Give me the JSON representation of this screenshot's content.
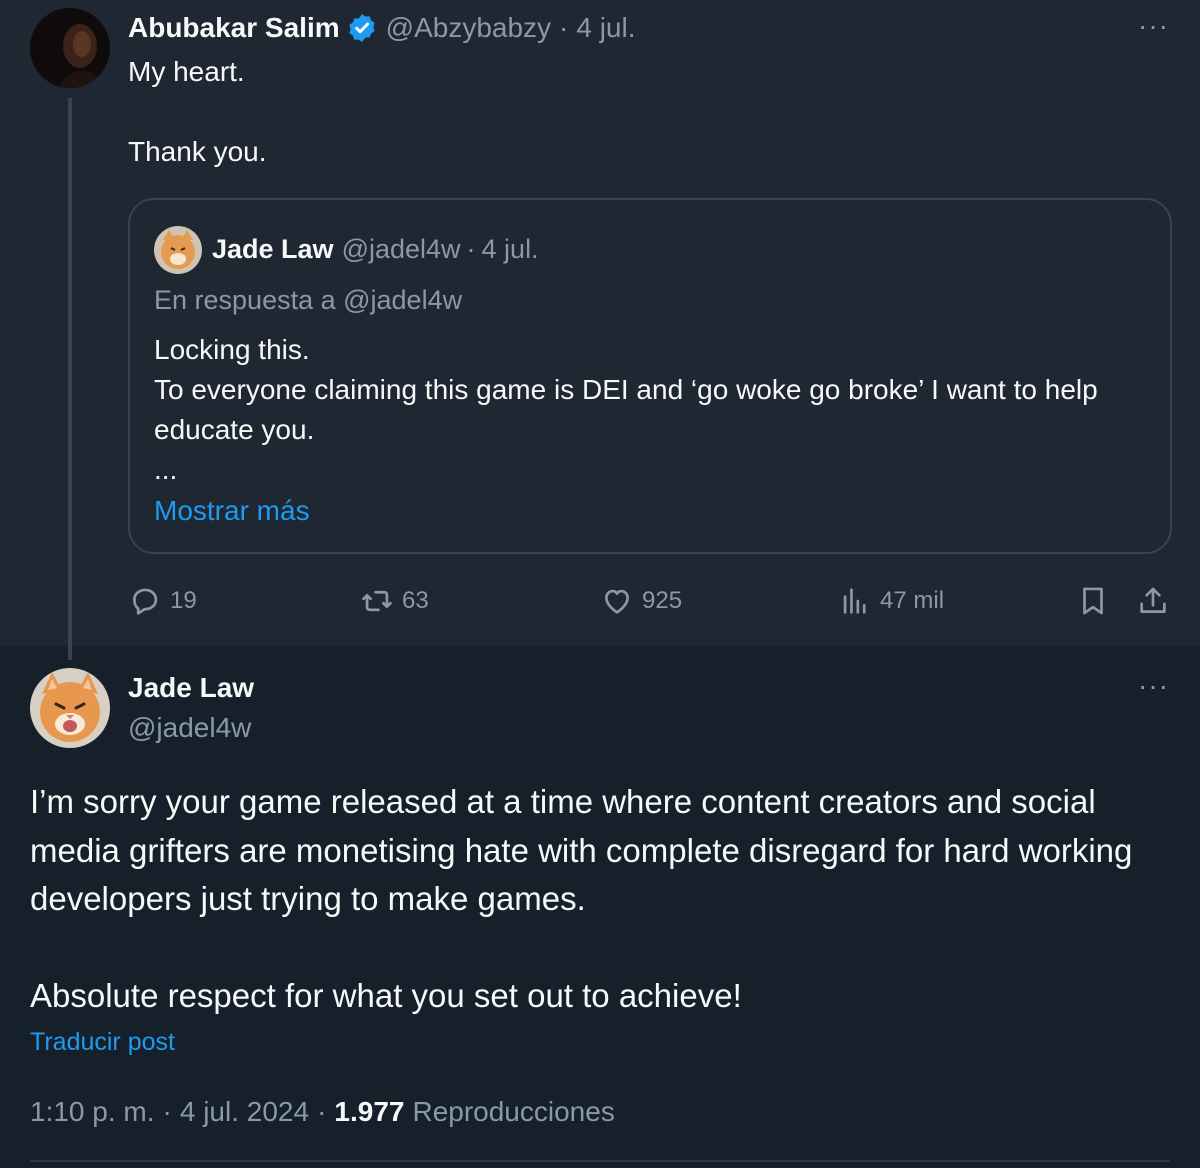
{
  "reply_tweet": {
    "author_name": "Abubakar Salim",
    "handle": "@Abzybabzy",
    "separator": "·",
    "date": "4 jul.",
    "text": "My heart.\n\nThank you.",
    "more_icon": "more-dots-icon",
    "verified_color": "#1d9bf0",
    "quoted": {
      "author_name": "Jade Law",
      "handle": "@jadel4w",
      "separator": "·",
      "date": "4 jul.",
      "reply_to": "En respuesta a @jadel4w",
      "text": "Locking this.\nTo everyone claiming this game is DEI and ‘go woke go broke’ I want to help educate you.\n...",
      "show_more": "Mostrar más"
    },
    "actions": {
      "replies": "19",
      "reposts": "63",
      "likes": "925",
      "views": "47 mil"
    }
  },
  "main_tweet": {
    "author_name": "Jade Law",
    "handle": "@jadel4w",
    "text": "I’m sorry your game released at a time where content creators and social media grifters are monetising hate with complete disregard for hard working developers just trying to make games.\n\nAbsolute respect for what you set out to achieve!",
    "translate": "Traducir post",
    "time": "1:10 p. m.",
    "separator": "·",
    "date": "4 jul. 2024",
    "views_count": "1.977",
    "views_label": "Reproducciones"
  },
  "colors": {
    "background": "#15202b",
    "reply_background": "#1e2732",
    "accent": "#1d9bf0",
    "muted": "#8b98a5"
  }
}
